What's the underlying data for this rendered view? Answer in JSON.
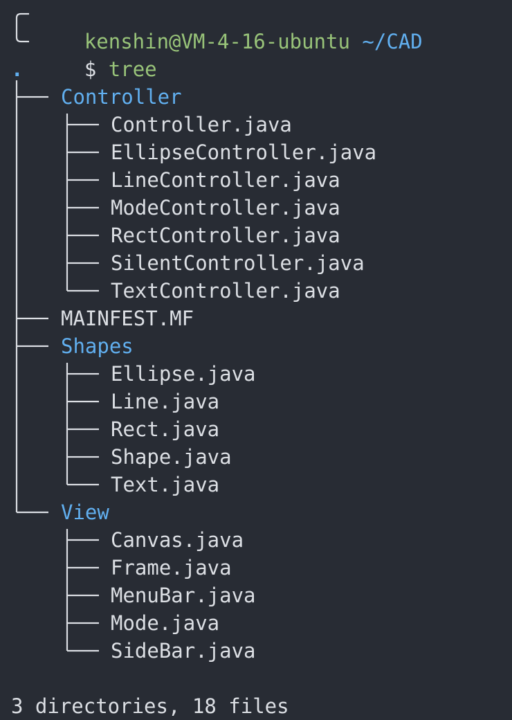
{
  "prompt": {
    "user_host": "kenshin@VM-4-16-ubuntu",
    "cwd": "~/CAD",
    "symbol": "$",
    "command": "tree"
  },
  "tree": {
    "root": ".",
    "entries": [
      {
        "name": "Controller",
        "kind": "directory",
        "depth": 1
      },
      {
        "name": "Controller.java",
        "kind": "file",
        "depth": 2
      },
      {
        "name": "EllipseController.java",
        "kind": "file",
        "depth": 2
      },
      {
        "name": "LineController.java",
        "kind": "file",
        "depth": 2
      },
      {
        "name": "ModeController.java",
        "kind": "file",
        "depth": 2
      },
      {
        "name": "RectController.java",
        "kind": "file",
        "depth": 2
      },
      {
        "name": "SilentController.java",
        "kind": "file",
        "depth": 2
      },
      {
        "name": "TextController.java",
        "kind": "file",
        "depth": 2
      },
      {
        "name": "MAINFEST.MF",
        "kind": "file",
        "depth": 1
      },
      {
        "name": "Shapes",
        "kind": "directory",
        "depth": 1
      },
      {
        "name": "Ellipse.java",
        "kind": "file",
        "depth": 2
      },
      {
        "name": "Line.java",
        "kind": "file",
        "depth": 2
      },
      {
        "name": "Rect.java",
        "kind": "file",
        "depth": 2
      },
      {
        "name": "Shape.java",
        "kind": "file",
        "depth": 2
      },
      {
        "name": "Text.java",
        "kind": "file",
        "depth": 2
      },
      {
        "name": "View",
        "kind": "directory",
        "depth": 1
      },
      {
        "name": "Canvas.java",
        "kind": "file",
        "depth": 2
      },
      {
        "name": "Frame.java",
        "kind": "file",
        "depth": 2
      },
      {
        "name": "MenuBar.java",
        "kind": "file",
        "depth": 2
      },
      {
        "name": "Mode.java",
        "kind": "file",
        "depth": 2
      },
      {
        "name": "SideBar.java",
        "kind": "file",
        "depth": 2
      }
    ]
  },
  "summary": "3 directories, 18 files",
  "colors": {
    "background": "#282c34",
    "prompt_green": "#98c379",
    "directory_blue": "#61afef",
    "file_text": "#dcdfe4"
  }
}
